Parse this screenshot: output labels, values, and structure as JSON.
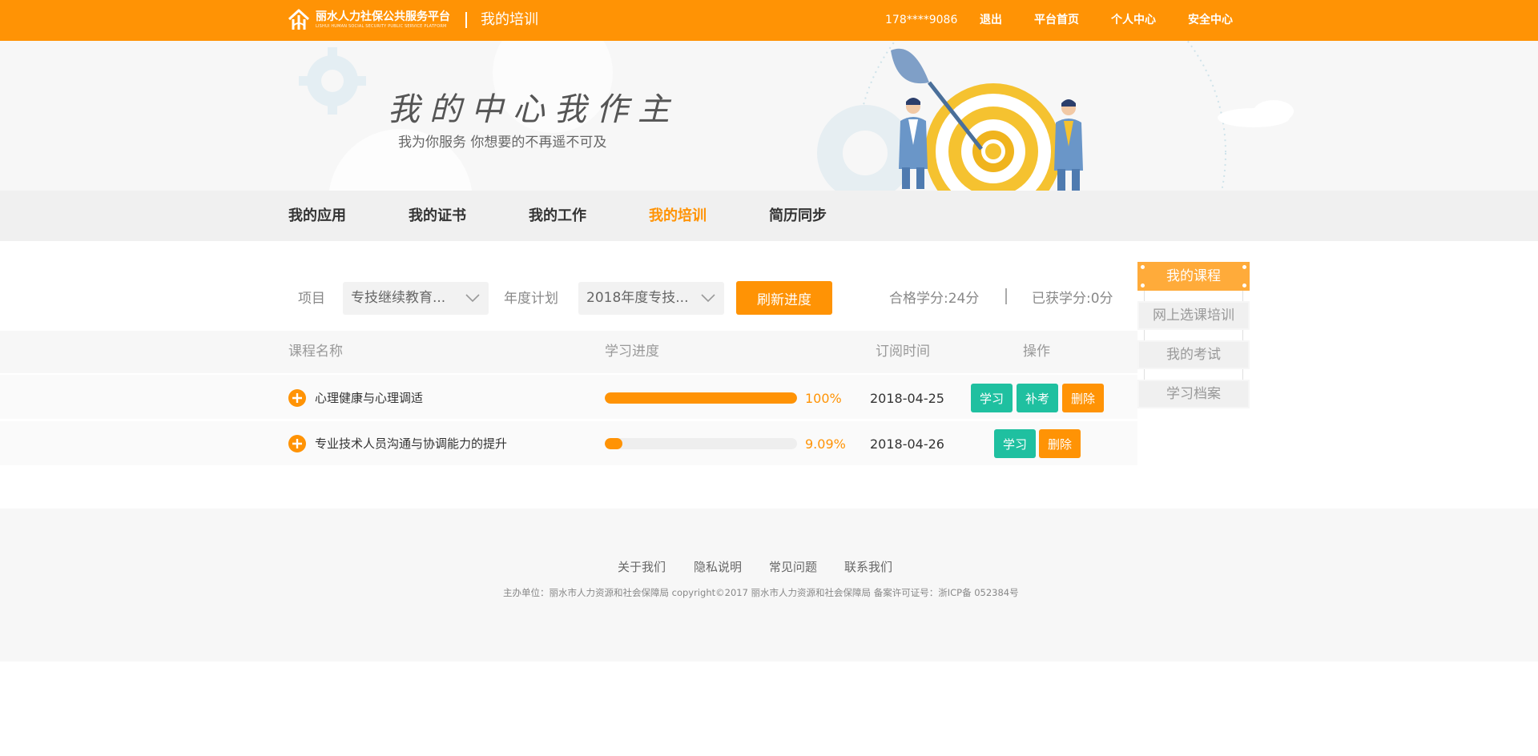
{
  "header": {
    "logo_cn": "丽水人力社保公共服务平台",
    "logo_en": "LISHUI HUMAN SOCIAL SECURITY PUBLIC SERVICE PLATFORM",
    "title": "我的培训",
    "phone": "178****9086",
    "logout": "退出",
    "home": "平台首页",
    "personal_center": "个人中心",
    "security_center": "安全中心",
    "brand_color": "#ff9305"
  },
  "banner": {
    "slogan": "我的中心我作主",
    "subtitle": "我为你服务 你想要的不再遥不可及"
  },
  "nav": {
    "tabs": [
      {
        "label": "我的应用"
      },
      {
        "label": "我的证书"
      },
      {
        "label": "我的工作"
      },
      {
        "label": "我的培训",
        "active": true
      },
      {
        "label": "简历同步"
      }
    ]
  },
  "filter": {
    "project_label": "项目",
    "project_value": "专技继续教育...",
    "plan_label": "年度计划",
    "plan_value": "2018年度专技...",
    "refresh_button": "刷新进度",
    "qualified_credit": "合格学分:24分",
    "earned_credit": "已获学分:0分"
  },
  "table": {
    "headers": [
      "课程名称",
      "学习进度",
      "订阅时间",
      "操作"
    ],
    "rows": [
      {
        "name": "心理健康与心理调适",
        "progress_text": "100%",
        "progress": 1.0,
        "date": "2018-04-25",
        "actions": [
          "学习",
          "补考",
          "删除"
        ]
      },
      {
        "name": "专业技术人员沟通与协调能力的提升",
        "progress_text": "9.09%",
        "progress": 0.0909,
        "date": "2018-04-26",
        "actions": [
          "学习",
          "删除"
        ]
      }
    ]
  },
  "side_menu": {
    "items": [
      {
        "label": "我的课程",
        "active": true
      },
      {
        "label": "网上选课培训"
      },
      {
        "label": "我的考试"
      },
      {
        "label": "学习档案"
      }
    ]
  },
  "footer": {
    "links": [
      "关于我们",
      "隐私说明",
      "常见问题",
      "联系我们"
    ],
    "copyright": "主办单位：丽水市人力资源和社会保障局 copyright©2017 丽水市人力资源和社会保障局 备案许可证号：浙ICP备 052384号"
  }
}
